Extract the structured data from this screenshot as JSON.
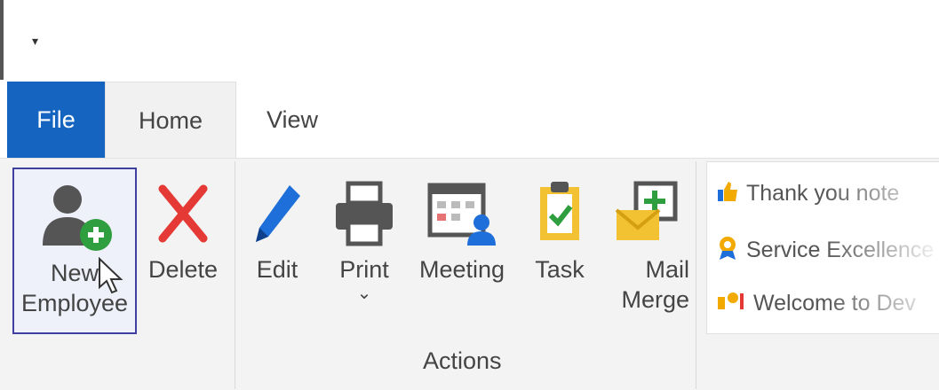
{
  "qat": {
    "dropdown_glyph": "▾"
  },
  "tabs": [
    {
      "label": "File",
      "active": false
    },
    {
      "label": "Home",
      "active": true
    },
    {
      "label": "View",
      "active": false
    }
  ],
  "ribbon": {
    "new_employee": {
      "line1": "New",
      "line2": "Employee",
      "icon": "user-add-icon"
    },
    "delete": {
      "label": "Delete",
      "icon": "delete-x-icon"
    },
    "actions_group": {
      "label": "Actions",
      "buttons": [
        {
          "label": "Edit",
          "icon": "pencil-icon"
        },
        {
          "label": "Print",
          "icon": "printer-icon",
          "dropdown": "⌄"
        },
        {
          "label": "Meeting",
          "icon": "calendar-icon"
        },
        {
          "label": "Task",
          "icon": "clipboard-check-icon"
        },
        {
          "line1": "Mail",
          "line2": "Merge",
          "icon": "mail-merge-icon"
        }
      ]
    },
    "gallery": [
      {
        "label": "Thank you note",
        "icon": "thumbs-up-icon"
      },
      {
        "label": "Service Excellence",
        "icon": "award-icon"
      },
      {
        "label": "Welcome to Dev",
        "icon": "welcome-icon"
      }
    ]
  },
  "colors": {
    "file_tab": "#1565c0",
    "accent_green": "#2e9e3e",
    "delete_red": "#e53935",
    "edit_blue": "#1e6fd9",
    "task_yellow": "#f2c232"
  }
}
